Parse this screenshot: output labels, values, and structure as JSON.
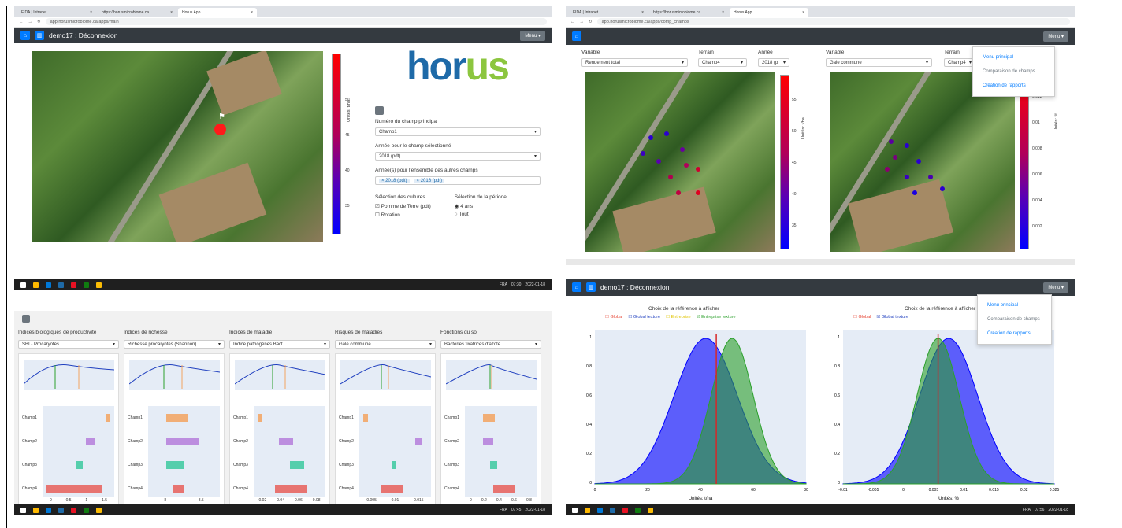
{
  "left_top": {
    "tabs": [
      "FIDA | Intranet",
      "https://horusmicrobiome.ca",
      "Horus App"
    ],
    "url": "app.horusmicrobiome.ca/apps/main",
    "nav_title": "demo17 : Déconnexion",
    "menu_label": "Menu ▾",
    "horus_logo": "horus",
    "colorbar_unit": "Unités: t/ha",
    "colorbar_ticks": [
      "50",
      "45",
      "40",
      "35"
    ],
    "form": {
      "champ_label": "Numéro du champ principal",
      "champ_value": "Champ1",
      "annee_label": "Année pour le champ sélectionné",
      "annee_value": "2018 (pdt)",
      "autres_label": "Année(s) pour l'ensemble des autres champs",
      "chips": [
        "× 2018 (pdt)",
        "× 2016 (pdt)"
      ],
      "cultures_label": "Sélection des cultures",
      "cult_1": "Pomme de Terre (pdt)",
      "cult_2": "Rotation",
      "periode_label": "Sélection de la période",
      "per_1": "4 ans",
      "per_2": "Tout"
    },
    "taskbar_time": "07:30",
    "taskbar_date": "2022-01-18",
    "taskbar_lang": "FRA"
  },
  "left_bottom": {
    "columns": [
      {
        "header": "Indices biologiques de productivité",
        "select": "SBI - Procaryotes",
        "ticks": [
          "0",
          "0.5",
          "1",
          "1.5"
        ]
      },
      {
        "header": "Indices de richesse",
        "select": "Richesse procaryotes (Shannon)",
        "ticks": [
          "8",
          "8.5"
        ]
      },
      {
        "header": "Indices de maladie",
        "select": "Indice pathogènes Bact.",
        "ticks": [
          "0.02",
          "0.04",
          "0.06",
          "0.08"
        ]
      },
      {
        "header": "Risques de maladies",
        "select": "Gale commune",
        "ticks": [
          "0.005",
          "0.01",
          "0.015"
        ]
      },
      {
        "header": "Fonctions du sol",
        "select": "Bactéries fixatrices d'azote",
        "ticks": [
          "0",
          "0.2",
          "0.4",
          "0.6",
          "0.8"
        ]
      }
    ],
    "rows": [
      "Champ1",
      "Champ2",
      "Champ3",
      "Champ4"
    ],
    "taskbar_time": "07:45",
    "taskbar_date": "2022-01-18",
    "taskbar_lang": "FRA"
  },
  "right_top": {
    "tabs": [
      "FIDA | Intranet",
      "https://horusmicrobiome.ca",
      "Horus App"
    ],
    "url": "app.horusmicrobiome.ca/apps/comp_champs",
    "variable_label": "Variable",
    "terrain_label": "Terrain",
    "annee_label": "Année",
    "var1": "Rendement total",
    "terrain1": "Champ4",
    "annee1": "2018 (p",
    "var2": "Gale commune",
    "terrain2": "Champ4",
    "unit1": "Unités: t/ha",
    "unit2": "Unités: %",
    "ticks1": [
      "55",
      "50",
      "45",
      "40",
      "35"
    ],
    "ticks2": [
      "0.012",
      "0.01",
      "0.008",
      "0.006",
      "0.004",
      "0.002"
    ],
    "menu_label": "Menu ▾",
    "menu_items": [
      "Menu principal",
      "Comparaison de champs",
      "Création de rapports"
    ]
  },
  "right_bottom": {
    "nav_title": "demo17 : Déconnexion",
    "menu_label": "Menu ▾",
    "menu_items": [
      "Menu principal",
      "Comparaison de champs",
      "Création de rapports"
    ],
    "chart1_title": "Choix de la référence à afficher",
    "chart2_title": "Choix de la référence à afficher",
    "legend": [
      "Global",
      "Global texture",
      "Entreprise",
      "Entreprise texture"
    ],
    "chart1_xlabel": "Unités: t/ha",
    "chart2_xlabel": "Unités: %",
    "chart1_xticks": [
      "0",
      "20",
      "40",
      "60",
      "80"
    ],
    "chart2_xticks": [
      "-0.01",
      "-0.005",
      "0",
      "0.005",
      "0.01",
      "0.015",
      "0.02",
      "0.025"
    ],
    "yticks": [
      "1",
      "0.8",
      "0.6",
      "0.4",
      "0.2",
      "0"
    ],
    "taskbar_time": "07:56",
    "taskbar_date": "2022-01-18",
    "taskbar_lang": "FRA"
  },
  "chart_data": [
    {
      "type": "area",
      "title": "Choix de la référence à afficher",
      "xlabel": "Unités: t/ha",
      "xlim": [
        0,
        80
      ],
      "ylim": [
        0,
        1
      ],
      "series": [
        {
          "name": "Global texture",
          "mean": 42,
          "sd": 12,
          "color": "#0000ff"
        },
        {
          "name": "Entreprise texture",
          "mean": 52,
          "sd": 8,
          "color": "#2ca02c"
        }
      ],
      "marker_x": 46
    },
    {
      "type": "area",
      "title": "Choix de la référence à afficher",
      "xlabel": "Unités: %",
      "xlim": [
        -0.012,
        0.028
      ],
      "ylim": [
        0,
        1
      ],
      "series": [
        {
          "name": "Global texture",
          "mean": 0.008,
          "sd": 0.0055,
          "color": "#0000ff"
        },
        {
          "name": "Entreprise texture",
          "mean": 0.006,
          "sd": 0.004,
          "color": "#2ca02c"
        }
      ],
      "marker_x": 0.006
    }
  ]
}
